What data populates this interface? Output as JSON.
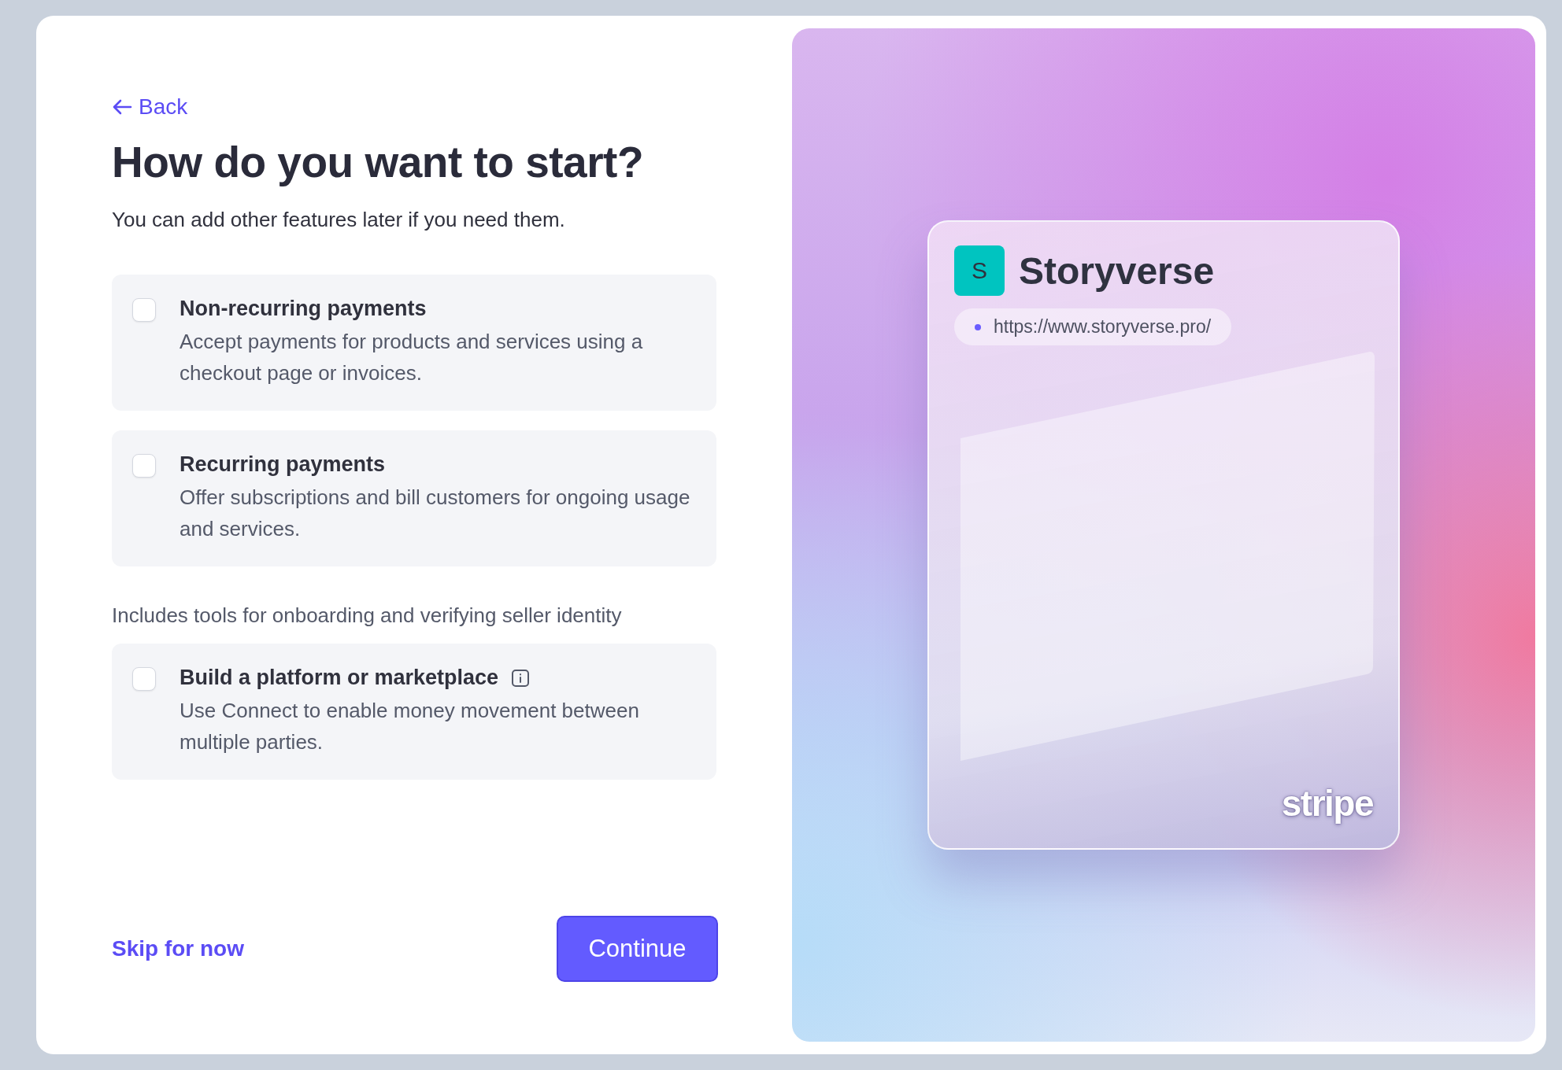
{
  "back_link": {
    "label": "Back"
  },
  "title": "How do you want to start?",
  "subtitle": "You can add other features later if you need them.",
  "options": [
    {
      "kind": "option",
      "title": "Non-recurring payments",
      "description": "Accept payments for products and services using a checkout page or invoices.",
      "checked": false,
      "info": false
    },
    {
      "kind": "option",
      "title": "Recurring payments",
      "description": "Offer subscriptions and bill customers for ongoing usage and services.",
      "checked": false,
      "info": false
    },
    {
      "kind": "note",
      "text": "Includes tools for onboarding and verifying seller identity"
    },
    {
      "kind": "option",
      "title": "Build a platform or marketplace",
      "description": "Use Connect to enable money movement between multiple parties.",
      "checked": false,
      "info": true
    }
  ],
  "footer": {
    "skip_link": "Skip for now",
    "continue_button": "Continue"
  },
  "preview": {
    "avatar_letter": "S",
    "site_name": "Storyverse",
    "url": "https://www.storyverse.pro/",
    "logo": "stripe"
  }
}
